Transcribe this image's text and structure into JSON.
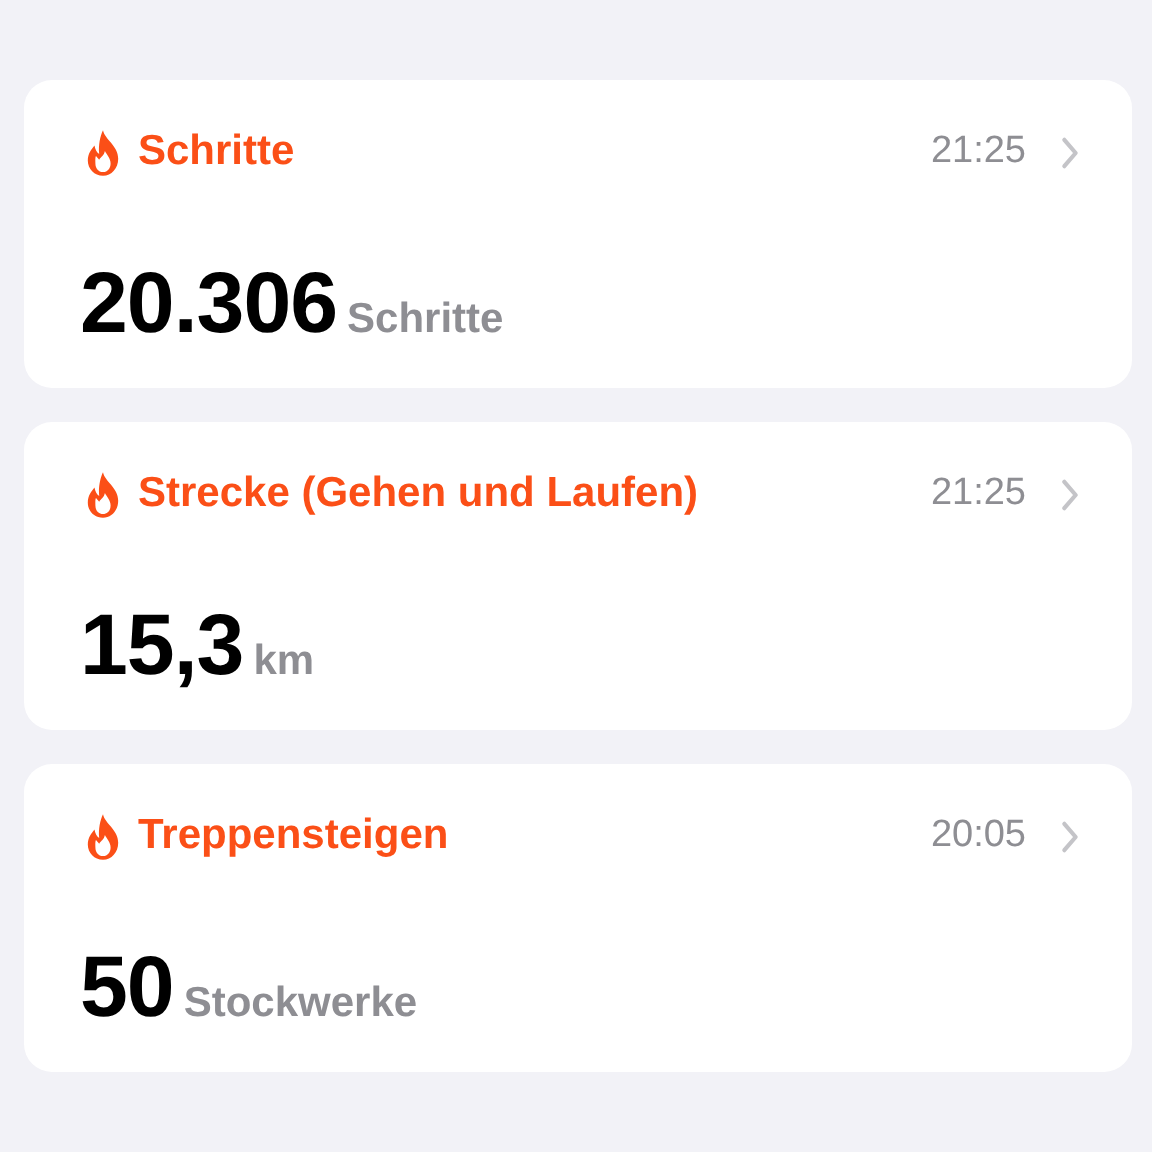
{
  "cards": [
    {
      "title": "Schritte",
      "time": "21:25",
      "value": "20.306",
      "unit": "Schritte"
    },
    {
      "title": "Strecke (Gehen und Laufen)",
      "time": "21:25",
      "value": "15,3",
      "unit": "km"
    },
    {
      "title": "Treppensteigen",
      "time": "20:05",
      "value": "50",
      "unit": "Stockwerke"
    }
  ]
}
